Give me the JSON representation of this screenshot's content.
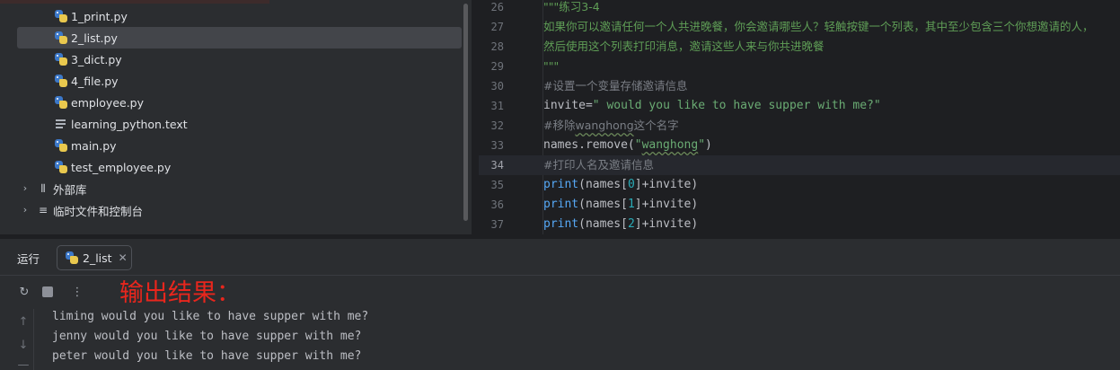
{
  "project_tree": {
    "files": [
      {
        "name": "1_print.py",
        "icon": "python-file-icon",
        "selected": false
      },
      {
        "name": "2_list.py",
        "icon": "python-file-icon",
        "selected": true
      },
      {
        "name": "3_dict.py",
        "icon": "python-file-icon",
        "selected": false
      },
      {
        "name": "4_file.py",
        "icon": "python-file-icon",
        "selected": false
      },
      {
        "name": "employee.py",
        "icon": "python-file-icon",
        "selected": false
      },
      {
        "name": "learning_python.text",
        "icon": "text-file-icon",
        "selected": false
      },
      {
        "name": "main.py",
        "icon": "python-file-icon",
        "selected": false
      },
      {
        "name": "test_employee.py",
        "icon": "python-file-icon",
        "selected": false
      }
    ],
    "groups": [
      {
        "name": "外部库",
        "icon": "library-icon"
      },
      {
        "name": "临时文件和控制台",
        "icon": "scratches-icon"
      }
    ]
  },
  "editor": {
    "active_line": "34",
    "lines": [
      {
        "num": "26",
        "text": "\"\"\"练习3-4"
      },
      {
        "num": "27",
        "text": "如果你可以邀请任何一个人共进晚餐，你会邀请哪些人？轻触按键一个列表，其中至少包含三个你想邀请的人，"
      },
      {
        "num": "28",
        "text": "然后使用这个列表打印消息，邀请这些人来与你共进晚餐"
      },
      {
        "num": "29",
        "text": "\"\"\""
      },
      {
        "num": "30",
        "text": "#设置一个变量存储邀请信息"
      },
      {
        "num": "31",
        "text_parts": [
          "invite=",
          "\" would you like to have supper with me?\""
        ]
      },
      {
        "num": "32",
        "text_parts": [
          "#移除",
          "wanghong",
          "这个名字"
        ]
      },
      {
        "num": "33",
        "text_parts": [
          "names.remove(",
          "\"",
          "wanghong",
          "\"",
          ")"
        ]
      },
      {
        "num": "34",
        "text": "#打印人名及邀请信息"
      },
      {
        "num": "35",
        "text_parts": [
          "print",
          "(names[",
          "0",
          "]+invite)"
        ]
      },
      {
        "num": "36",
        "text_parts": [
          "print",
          "(names[",
          "1",
          "]+invite)"
        ]
      },
      {
        "num": "37",
        "text_parts": [
          "print",
          "(names[",
          "2",
          "]+invite)"
        ]
      }
    ]
  },
  "run_panel": {
    "title": "运行",
    "tab_label": "2_list",
    "annotation": "输出结果：",
    "output": [
      "liming would you like to have supper with me?",
      "jenny would you like to have supper with me?",
      "peter would you like to have supper with me?"
    ]
  },
  "colors": {
    "accent_red": "#e8261d",
    "string_green": "#6aab73",
    "keyword_blue": "#56a8f5",
    "number_teal": "#2aacb8",
    "docstring_green": "#5f9e56"
  }
}
